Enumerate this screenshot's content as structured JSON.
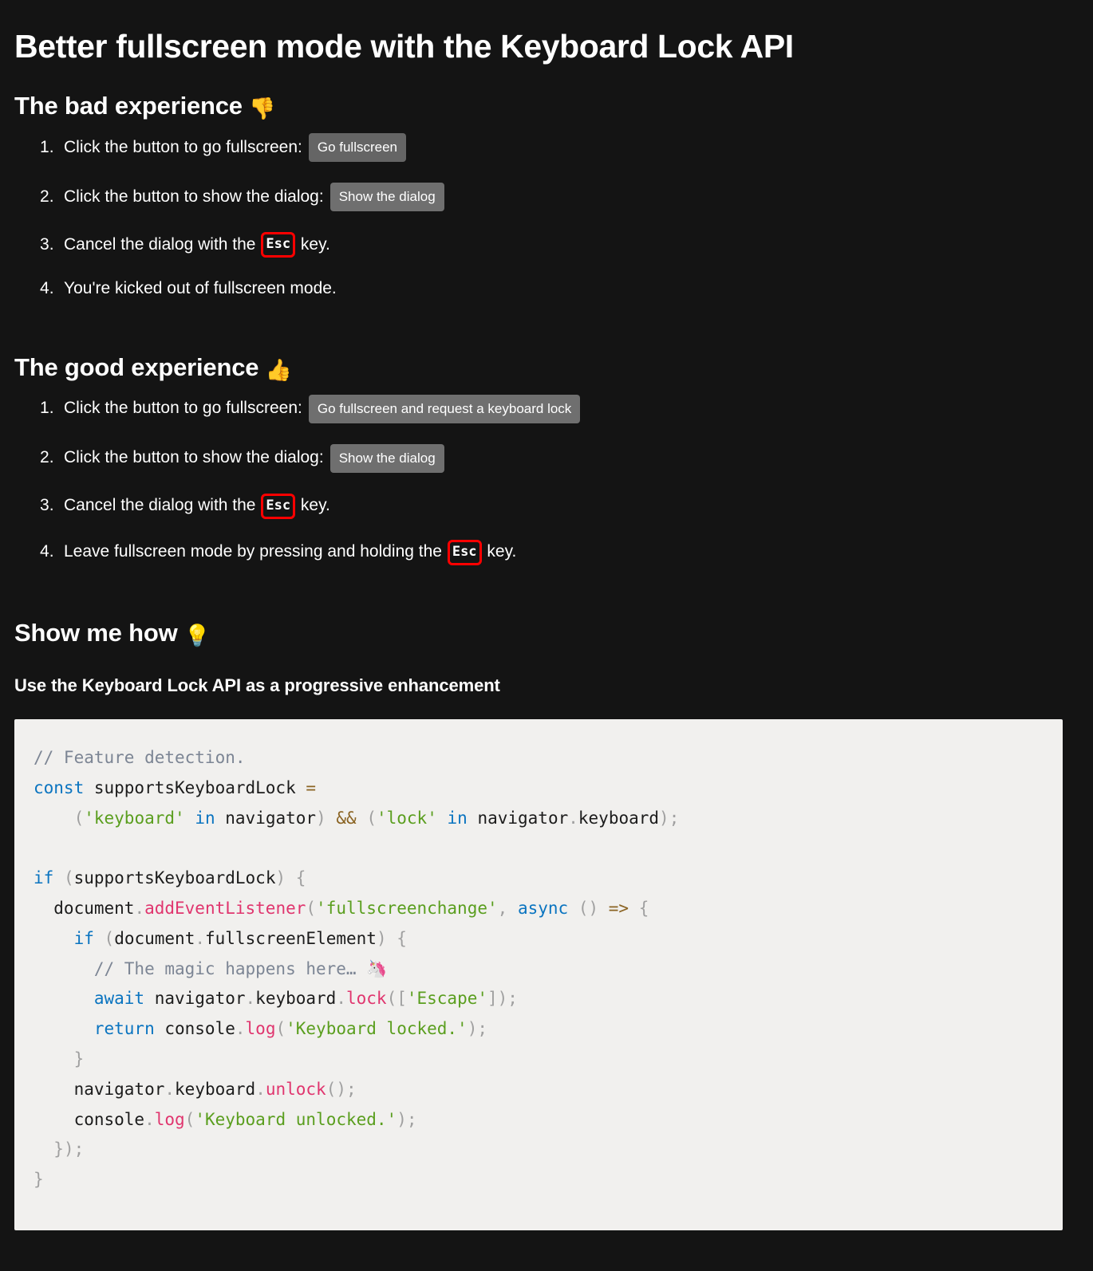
{
  "page": {
    "background_color": "#141414",
    "text_color": "#ffffff",
    "title": "Better fullscreen mode with the Keyboard Lock API"
  },
  "sections": {
    "bad": {
      "heading": "The bad experience",
      "heading_emoji": "👎",
      "steps": [
        {
          "prefix": "Click the button to go fullscreen:",
          "button": "Go fullscreen"
        },
        {
          "prefix": "Click the button to show the dialog:",
          "button": "Show the dialog"
        },
        {
          "prefix": "Cancel the dialog with the",
          "kbd": "Esc",
          "suffix": "key."
        },
        {
          "prefix": "You're kicked out of fullscreen mode."
        }
      ]
    },
    "good": {
      "heading": "The good experience",
      "heading_emoji": "👍",
      "steps": [
        {
          "prefix": "Click the button to go fullscreen:",
          "button": "Go fullscreen and request a keyboard lock"
        },
        {
          "prefix": "Click the button to show the dialog:",
          "button": "Show the dialog"
        },
        {
          "prefix": "Cancel the dialog with the",
          "kbd": "Esc",
          "suffix": "key."
        },
        {
          "prefix": "Leave fullscreen mode by pressing and holding the",
          "kbd": "Esc",
          "suffix": "key."
        }
      ]
    },
    "how": {
      "heading": "Show me how",
      "heading_emoji": "💡",
      "subheading": "Use the Keyboard Lock API as a progressive enhancement"
    }
  },
  "code": {
    "background_color": "#f1f0ee",
    "language": "javascript",
    "colors": {
      "comment": "#7c8594",
      "keyword": "#0a74c0",
      "string": "#5a9e1e",
      "operator": "#8a6322",
      "function": "#e0356e",
      "punctuation": "#a0a0a0",
      "plain": "#1c1c1c"
    },
    "tokens": [
      [
        {
          "t": "comment",
          "v": "// Feature detection."
        }
      ],
      [
        {
          "t": "keyword",
          "v": "const"
        },
        {
          "t": "plain",
          "v": " supportsKeyboardLock "
        },
        {
          "t": "operator",
          "v": "="
        }
      ],
      [
        {
          "t": "plain",
          "v": "    "
        },
        {
          "t": "punct",
          "v": "("
        },
        {
          "t": "string",
          "v": "'keyboard'"
        },
        {
          "t": "plain",
          "v": " "
        },
        {
          "t": "keyword",
          "v": "in"
        },
        {
          "t": "plain",
          "v": " navigator"
        },
        {
          "t": "punct",
          "v": ")"
        },
        {
          "t": "plain",
          "v": " "
        },
        {
          "t": "operator",
          "v": "&&"
        },
        {
          "t": "plain",
          "v": " "
        },
        {
          "t": "punct",
          "v": "("
        },
        {
          "t": "string",
          "v": "'lock'"
        },
        {
          "t": "plain",
          "v": " "
        },
        {
          "t": "keyword",
          "v": "in"
        },
        {
          "t": "plain",
          "v": " navigator"
        },
        {
          "t": "punct",
          "v": "."
        },
        {
          "t": "plain",
          "v": "keyboard"
        },
        {
          "t": "punct",
          "v": ");"
        }
      ],
      [],
      [
        {
          "t": "keyword",
          "v": "if"
        },
        {
          "t": "plain",
          "v": " "
        },
        {
          "t": "punct",
          "v": "("
        },
        {
          "t": "plain",
          "v": "supportsKeyboardLock"
        },
        {
          "t": "punct",
          "v": ")"
        },
        {
          "t": "plain",
          "v": " "
        },
        {
          "t": "punct",
          "v": "{"
        }
      ],
      [
        {
          "t": "plain",
          "v": "  document"
        },
        {
          "t": "punct",
          "v": "."
        },
        {
          "t": "func",
          "v": "addEventListener"
        },
        {
          "t": "punct",
          "v": "("
        },
        {
          "t": "string",
          "v": "'fullscreenchange'"
        },
        {
          "t": "punct",
          "v": ","
        },
        {
          "t": "plain",
          "v": " "
        },
        {
          "t": "keyword",
          "v": "async"
        },
        {
          "t": "plain",
          "v": " "
        },
        {
          "t": "punct",
          "v": "()"
        },
        {
          "t": "plain",
          "v": " "
        },
        {
          "t": "operator",
          "v": "=>"
        },
        {
          "t": "plain",
          "v": " "
        },
        {
          "t": "punct",
          "v": "{"
        }
      ],
      [
        {
          "t": "plain",
          "v": "    "
        },
        {
          "t": "keyword",
          "v": "if"
        },
        {
          "t": "plain",
          "v": " "
        },
        {
          "t": "punct",
          "v": "("
        },
        {
          "t": "plain",
          "v": "document"
        },
        {
          "t": "punct",
          "v": "."
        },
        {
          "t": "plain",
          "v": "fullscreenElement"
        },
        {
          "t": "punct",
          "v": ")"
        },
        {
          "t": "plain",
          "v": " "
        },
        {
          "t": "punct",
          "v": "{"
        }
      ],
      [
        {
          "t": "plain",
          "v": "      "
        },
        {
          "t": "comment",
          "v": "// The magic happens here… "
        },
        {
          "t": "emoji",
          "v": "🦄"
        }
      ],
      [
        {
          "t": "plain",
          "v": "      "
        },
        {
          "t": "keyword",
          "v": "await"
        },
        {
          "t": "plain",
          "v": " navigator"
        },
        {
          "t": "punct",
          "v": "."
        },
        {
          "t": "plain",
          "v": "keyboard"
        },
        {
          "t": "punct",
          "v": "."
        },
        {
          "t": "func",
          "v": "lock"
        },
        {
          "t": "punct",
          "v": "(["
        },
        {
          "t": "string",
          "v": "'Escape'"
        },
        {
          "t": "punct",
          "v": "]);"
        }
      ],
      [
        {
          "t": "plain",
          "v": "      "
        },
        {
          "t": "keyword",
          "v": "return"
        },
        {
          "t": "plain",
          "v": " console"
        },
        {
          "t": "punct",
          "v": "."
        },
        {
          "t": "func",
          "v": "log"
        },
        {
          "t": "punct",
          "v": "("
        },
        {
          "t": "string",
          "v": "'Keyboard locked.'"
        },
        {
          "t": "punct",
          "v": ");"
        }
      ],
      [
        {
          "t": "plain",
          "v": "    "
        },
        {
          "t": "punct",
          "v": "}"
        }
      ],
      [
        {
          "t": "plain",
          "v": "    navigator"
        },
        {
          "t": "punct",
          "v": "."
        },
        {
          "t": "plain",
          "v": "keyboard"
        },
        {
          "t": "punct",
          "v": "."
        },
        {
          "t": "func",
          "v": "unlock"
        },
        {
          "t": "punct",
          "v": "();"
        }
      ],
      [
        {
          "t": "plain",
          "v": "    console"
        },
        {
          "t": "punct",
          "v": "."
        },
        {
          "t": "func",
          "v": "log"
        },
        {
          "t": "punct",
          "v": "("
        },
        {
          "t": "string",
          "v": "'Keyboard unlocked.'"
        },
        {
          "t": "punct",
          "v": ");"
        }
      ],
      [
        {
          "t": "plain",
          "v": "  "
        },
        {
          "t": "punct",
          "v": "});"
        }
      ],
      [
        {
          "t": "punct",
          "v": "}"
        }
      ]
    ]
  }
}
